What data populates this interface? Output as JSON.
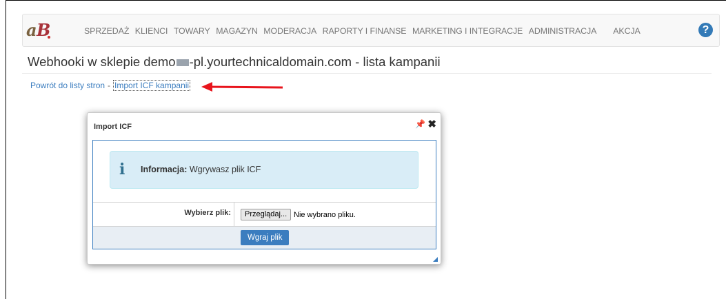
{
  "nav": {
    "items": [
      "SPRZEDAŻ",
      "KLIENCI",
      "TOWARY",
      "MAGAZYN",
      "MODERACJA",
      "RAPORTY I FINANSE",
      "MARKETING I INTEGRACJE",
      "ADMINISTRACJA",
      "AKCJA"
    ],
    "help": "?"
  },
  "page": {
    "title_prefix": "Webhooki w sklepie demo",
    "title_suffix": "-pl.yourtechnicaldomain.com - lista kampanii"
  },
  "breadcrumb": {
    "back": "Powrót do listy stron",
    "separator": "-",
    "current": "Import ICF kampanii"
  },
  "dialog": {
    "title": "Import ICF",
    "info_icon": "i",
    "info_label": "Informacja:",
    "info_text": " Wgrywasz plik ICF",
    "file_label": "Wybierz plik:",
    "browse_label": "Przeglądaj...",
    "no_file_text": "Nie wybrano pliku.",
    "upload_label": "Wgraj plik"
  },
  "colors": {
    "accent": "#3b7dbf",
    "info_bg": "#d9edf7",
    "arrow": "#e8141c"
  }
}
